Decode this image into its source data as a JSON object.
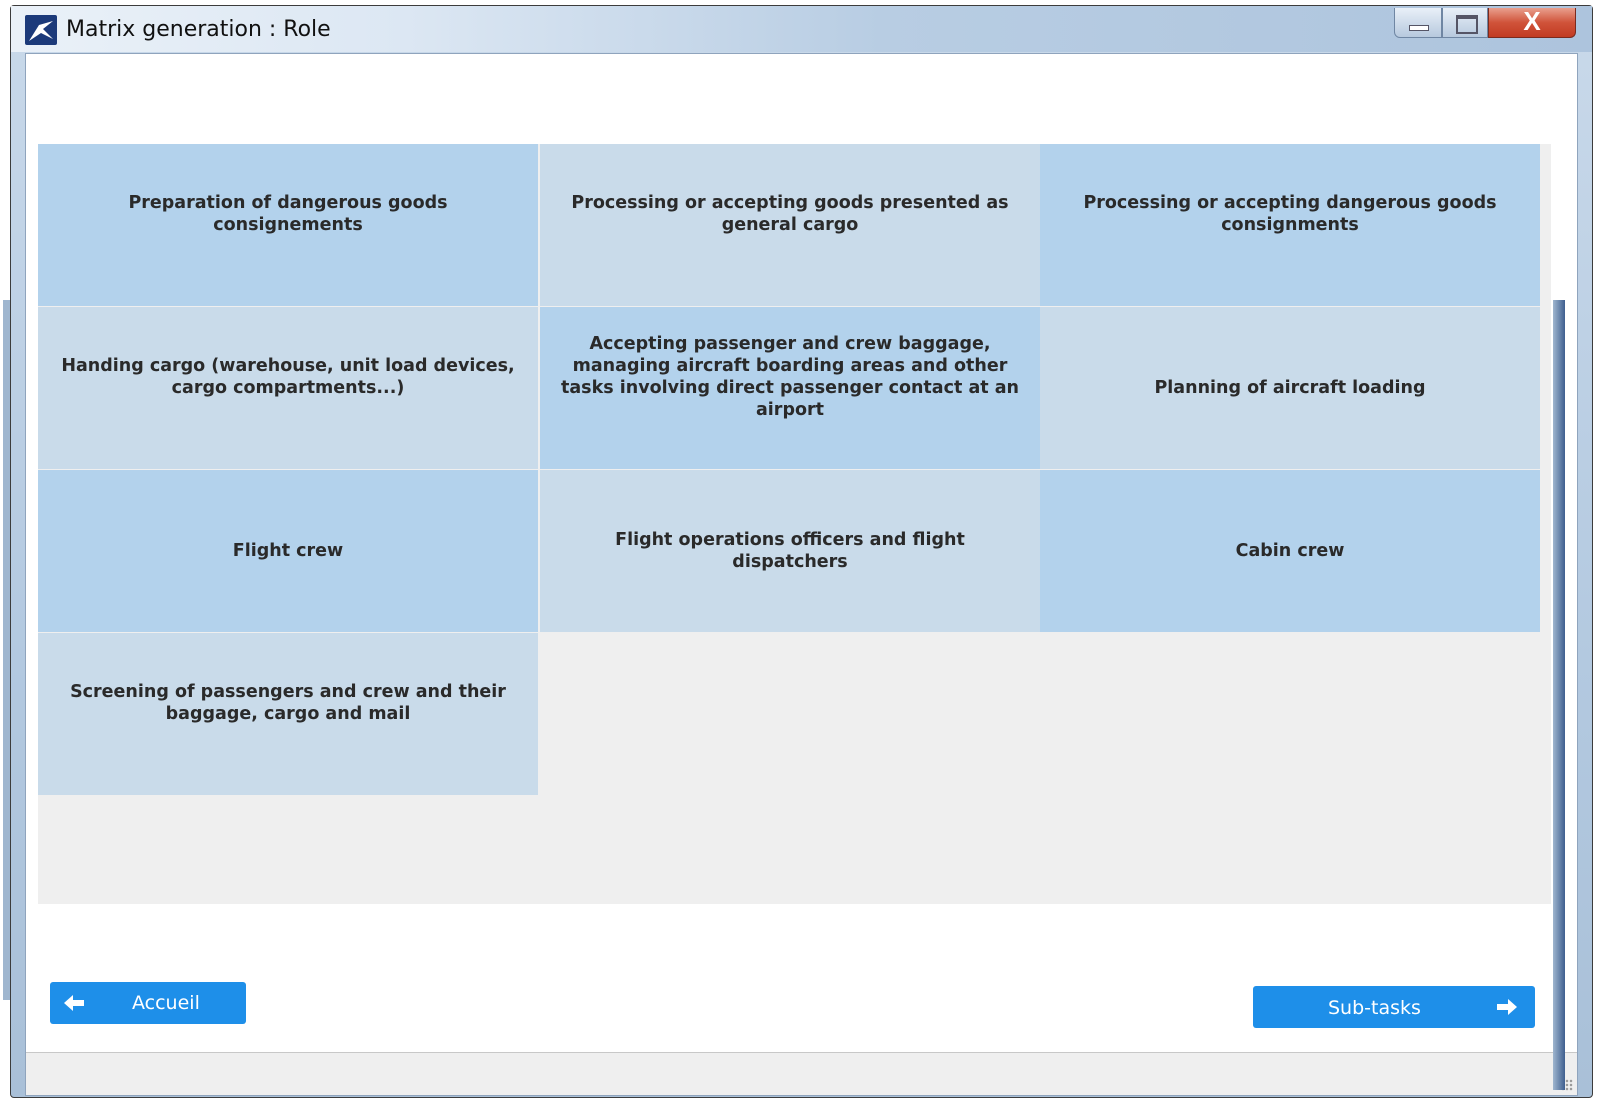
{
  "window": {
    "title": "Matrix generation :  Role",
    "close_glyph": "X"
  },
  "roles": [
    {
      "label": "Preparation of dangerous goods consignements"
    },
    {
      "label": "Processing or accepting goods presented as general cargo"
    },
    {
      "label": "Processing or accepting dangerous goods consignments"
    },
    {
      "label": "Handing cargo (warehouse, unit load devices, cargo compartments...)"
    },
    {
      "label": "Accepting passenger and crew baggage, managing aircraft boarding areas and other tasks involving direct passenger contact at an airport"
    },
    {
      "label": "Planning of aircraft loading"
    },
    {
      "label": "Flight crew"
    },
    {
      "label": "Flight operations officers and flight dispatchers"
    },
    {
      "label": "Cabin crew"
    },
    {
      "label": "Screening of passengers and crew and their baggage, cargo and mail"
    }
  ],
  "nav": {
    "home_label": "Accueil",
    "next_label": "Sub-tasks"
  },
  "colors": {
    "tile_dark": "#b3d2ec",
    "tile_light": "#c9dbea",
    "button": "#1e8fe9"
  },
  "icons": {
    "app": "app-logo-icon",
    "back": "arrow-left-icon",
    "next": "arrow-right-icon"
  }
}
